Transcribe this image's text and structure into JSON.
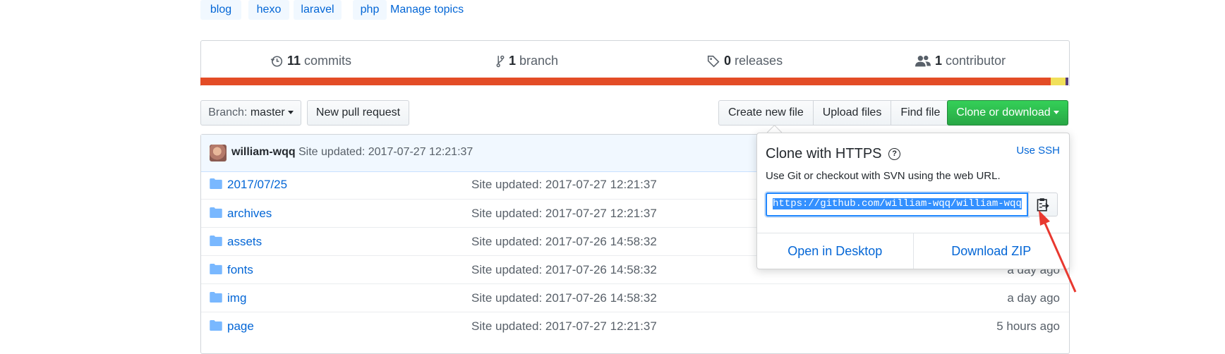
{
  "topics": [
    "blog",
    "hexo",
    "laravel",
    "php"
  ],
  "manage_topics": "Manage topics",
  "stats": {
    "commits": {
      "num": "11",
      "label": "commits"
    },
    "branches": {
      "num": "1",
      "label": "branch"
    },
    "releases": {
      "num": "0",
      "label": "releases"
    },
    "contributors": {
      "num": "1",
      "label": "contributor"
    }
  },
  "language_bar": [
    {
      "color": "#e34c26",
      "percent": 98.0
    },
    {
      "color": "#f1e05a",
      "percent": 1.7
    },
    {
      "color": "#563d7c",
      "percent": 0.3
    }
  ],
  "toolbar": {
    "branch_prefix": "Branch:",
    "branch_name": "master",
    "new_pull_request": "New pull request",
    "create_new_file": "Create new file",
    "upload_files": "Upload files",
    "find_file": "Find file",
    "clone_or_download": "Clone or download"
  },
  "latest_commit": {
    "author": "william-wqq",
    "message": "Site updated: 2017-07-27 12:21:37"
  },
  "files": [
    {
      "name": "2017/07/25",
      "message": "Site updated: 2017-07-27 12:21:37",
      "age": ""
    },
    {
      "name": "archives",
      "message": "Site updated: 2017-07-27 12:21:37",
      "age": ""
    },
    {
      "name": "assets",
      "message": "Site updated: 2017-07-26 14:58:32",
      "age": ""
    },
    {
      "name": "fonts",
      "message": "Site updated: 2017-07-26 14:58:32",
      "age": "a day ago"
    },
    {
      "name": "img",
      "message": "Site updated: 2017-07-26 14:58:32",
      "age": "a day ago"
    },
    {
      "name": "page",
      "message": "Site updated: 2017-07-27 12:21:37",
      "age": "5 hours ago"
    }
  ],
  "clone_popup": {
    "title": "Clone with HTTPS",
    "help_icon": "question-icon",
    "use_ssh": "Use SSH",
    "description": "Use Git or checkout with SVN using the web URL.",
    "url": "https://github.com/william-wqq/william-wqq",
    "copy_icon": "clipboard-icon",
    "open_in_desktop": "Open in Desktop",
    "download_zip": "Download ZIP"
  },
  "colors": {
    "link": "#0366d6",
    "clone_button": "#28a745",
    "annotation_arrow": "#e8382f"
  }
}
